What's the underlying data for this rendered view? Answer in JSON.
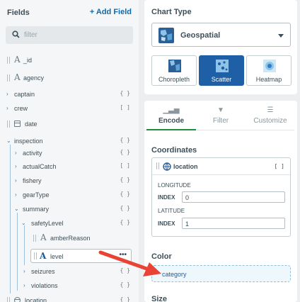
{
  "fields_panel": {
    "title": "Fields",
    "add_field": "Add Field",
    "search_placeholder": "filter",
    "rows": [
      {
        "label": "_id",
        "type_glyph": ""
      },
      {
        "label": "agency",
        "type_glyph": ""
      },
      {
        "label": "captain",
        "type_glyph": "{ }"
      },
      {
        "label": "crew",
        "type_glyph": "[ ]"
      },
      {
        "label": "date",
        "type_glyph": ""
      },
      {
        "label": "inspection",
        "type_glyph": "{ }"
      },
      {
        "label": "activity",
        "type_glyph": "{ }"
      },
      {
        "label": "actualCatch",
        "type_glyph": "[ ]"
      },
      {
        "label": "fishery",
        "type_glyph": "{ }"
      },
      {
        "label": "gearType",
        "type_glyph": "{ }"
      },
      {
        "label": "summary",
        "type_glyph": "{ }"
      },
      {
        "label": "safetyLevel",
        "type_glyph": "{ }"
      },
      {
        "label": "amberReason",
        "type_glyph": ""
      },
      {
        "label": "level",
        "type_glyph": "•••"
      },
      {
        "label": "seizures",
        "type_glyph": "{ }"
      },
      {
        "label": "violations",
        "type_glyph": "{ }"
      },
      {
        "label": "location",
        "type_glyph": "{ }"
      }
    ]
  },
  "chart_type": {
    "title": "Chart Type",
    "selected": "Geospatial",
    "options": [
      {
        "label": "Choropleth"
      },
      {
        "label": "Scatter"
      },
      {
        "label": "Heatmap"
      }
    ]
  },
  "encode_panel": {
    "tabs": [
      {
        "label": "Encode"
      },
      {
        "label": "Filter"
      },
      {
        "label": "Customize"
      }
    ],
    "coordinates": {
      "title": "Coordinates",
      "field": "location",
      "field_type_glyph": "[ ]",
      "longitude_label": "LONGITUDE",
      "latitude_label": "LATITUDE",
      "index_label": "INDEX",
      "longitude_index": "0",
      "latitude_index": "1"
    },
    "color": {
      "title": "Color",
      "value": "category"
    },
    "size": {
      "title": "Size"
    }
  },
  "colors": {
    "accent": "#0f6aa8",
    "selected_tile": "#1f5fa6",
    "active_tab": "#1e8b3e",
    "arrow": "#ea4335"
  }
}
